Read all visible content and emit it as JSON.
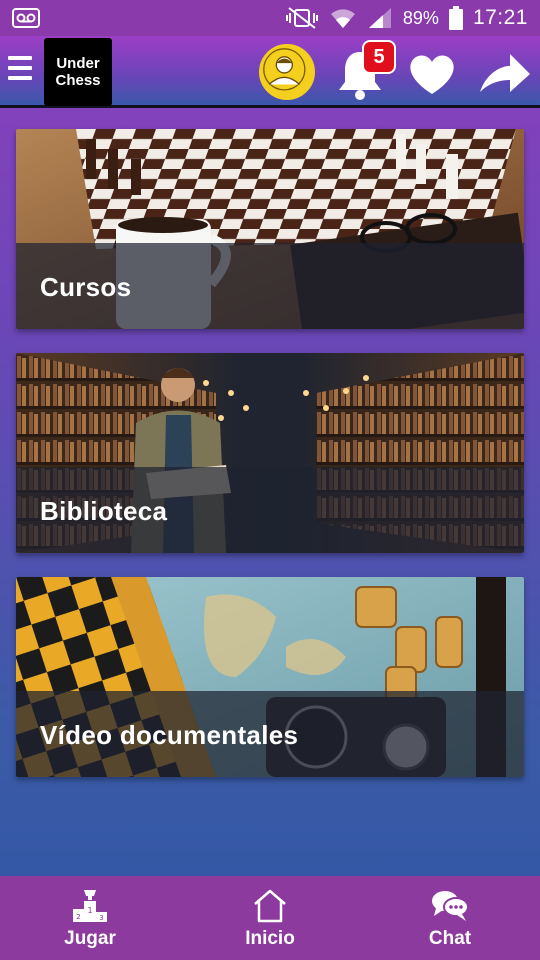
{
  "status_bar": {
    "battery_percent": "89%",
    "time": "17:21"
  },
  "header": {
    "logo_line1": "Under",
    "logo_line2": "Chess",
    "notification_count": "5",
    "accent_color": "#8e3fbf"
  },
  "cards": [
    {
      "title": "Cursos"
    },
    {
      "title": "Biblioteca"
    },
    {
      "title": "Vídeo documentales"
    }
  ],
  "bottom_nav": {
    "items": [
      {
        "label": "Jugar",
        "icon": "podium-icon"
      },
      {
        "label": "Inicio",
        "icon": "home-icon"
      },
      {
        "label": "Chat",
        "icon": "chat-bubbles-icon"
      }
    ],
    "background": "#8c3a9e"
  }
}
